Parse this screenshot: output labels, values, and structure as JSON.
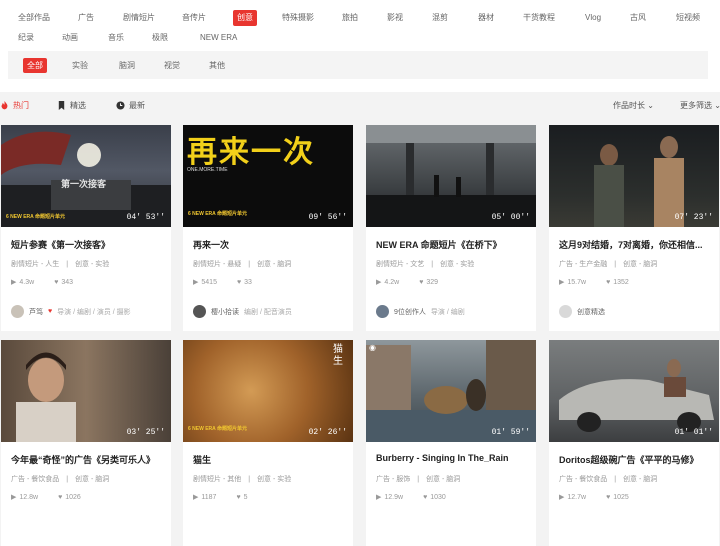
{
  "categories": [
    "全部作品",
    "广告",
    "剧情短片",
    "音传片",
    "创意",
    "特殊摄影",
    "旅拍",
    "影视",
    "混剪",
    "器材",
    "干货教程",
    "Vlog",
    "古风",
    "短视频",
    "纪录",
    "动画",
    "音乐",
    "极限",
    "NEW ERA"
  ],
  "active_category": "创意",
  "subcategories": [
    "全部",
    "实验",
    "脑洞",
    "视觉",
    "其他"
  ],
  "active_subcategory": "全部",
  "sort": {
    "hot": "热门",
    "picked": "精选",
    "latest": "最新",
    "duration": "作品时长",
    "more": "更多筛选"
  },
  "cards": [
    {
      "title": "短片参赛《第一次接客》",
      "tags": "剧情短片 - 人生　|　创意 - 实验",
      "views": "4.3w",
      "likes": "343",
      "author": "芦笃",
      "roles": "导演 / 编剧 / 演员 / 摄影",
      "duration": "04' 53''",
      "badge": "6 NEW ERA 命题短片单元",
      "overlay": "第一次接客"
    },
    {
      "title": "再来一次",
      "tags": "剧情短片 - 悬疑　|　创意 - 脑洞",
      "views": "5415",
      "likes": "33",
      "author": "樱小拾读",
      "roles": "编剧 / 配音演员",
      "duration": "09' 56''",
      "badge": "6 NEW ERA 命题短片单元",
      "overlay": "再来一次",
      "overlay2": "ONE.MORE.TIME"
    },
    {
      "title": "NEW ERA 命题短片《在桥下》",
      "tags": "剧情短片 - 文艺　|　创意 - 实验",
      "views": "4.2w",
      "likes": "329",
      "author": "9位创作人",
      "roles": "导演 / 编剧",
      "duration": "05' 00''"
    },
    {
      "title": "这月9对结婚，7对离婚，你还相信...",
      "tags": "广告 - 生产金融　|　创意 - 脑洞",
      "views": "15.7w",
      "likes": "1352",
      "author": "创意精选",
      "roles": "",
      "duration": "07' 23''"
    },
    {
      "title": "今年最“奇怪”的广告《另类可乐人》",
      "tags": "广告 - 餐饮食品　|　创意 - 脑洞",
      "views": "12.8w",
      "likes": "1026",
      "duration": "03' 25''"
    },
    {
      "title": "猫生",
      "tags": "剧情短片 - 其他　|　创意 - 实验",
      "views": "1187",
      "likes": "5",
      "duration": "02' 26''",
      "badge": "6 NEW ERA 命题短片单元",
      "overlay": "猫 生"
    },
    {
      "title": "Burberry - Singing In The_Rain",
      "tags": "广告 - 服饰　|　创意 - 脑洞",
      "views": "12.9w",
      "likes": "1030",
      "duration": "01' 59''"
    },
    {
      "title": "Doritos超级碗广告《平平的马修》",
      "tags": "广告 - 餐饮食品　|　创意 - 脑洞",
      "views": "12.7w",
      "likes": "1025",
      "duration": "01' 01''"
    }
  ]
}
